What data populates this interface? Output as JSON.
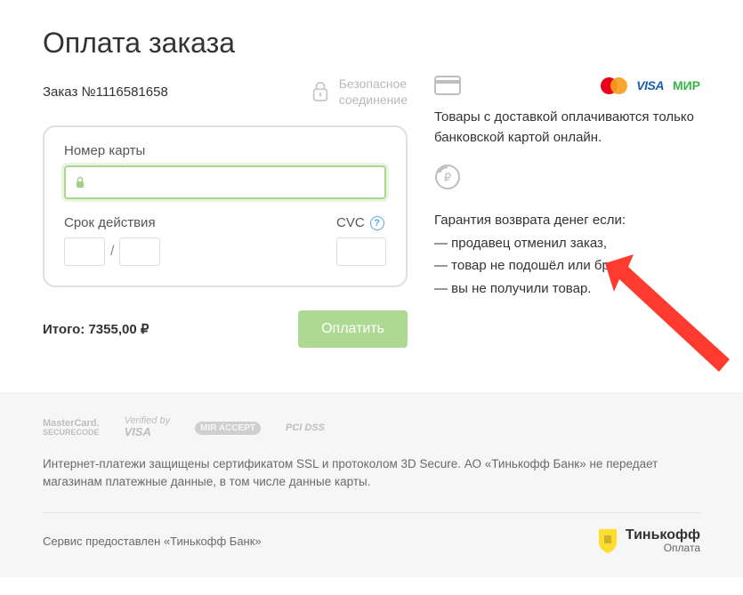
{
  "title": "Оплата заказа",
  "order_label": "Заказ №1116581658",
  "secure_label": "Безопасное\nсоединение",
  "card": {
    "number_label": "Номер карты",
    "expiry_label": "Срок действия",
    "cvc_label": "CVC"
  },
  "total_label": "Итого: 7355,00 ₽",
  "pay_button": "Оплатить",
  "info": {
    "delivery_text": "Товары с доставкой оплачиваются только банковской картой онлайн.",
    "guarantee_title": "Гарантия возврата денег если:",
    "g1": "— продавец отменил заказ,",
    "g2": "— товар не подошёл или брак,",
    "g3": "— вы не получили товар."
  },
  "footer": {
    "logos": {
      "mc1": "MasterCard.",
      "mc2": "SECURECODE",
      "v1": "Verified by",
      "v2": "VISA",
      "mir": "MIR ACCEPT",
      "pci": "PCI DSS"
    },
    "text": "Интернет-платежи защищены сертификатом SSL и протоколом 3D Secure. АО «Тинькофф Банк» не передает магазинам платежные данные, в том числе данные карты.",
    "service": "Сервис предоставлен «Тинькофф Банк»",
    "tinkoff_name": "Тинькофф",
    "tinkoff_sub": "Оплата"
  }
}
